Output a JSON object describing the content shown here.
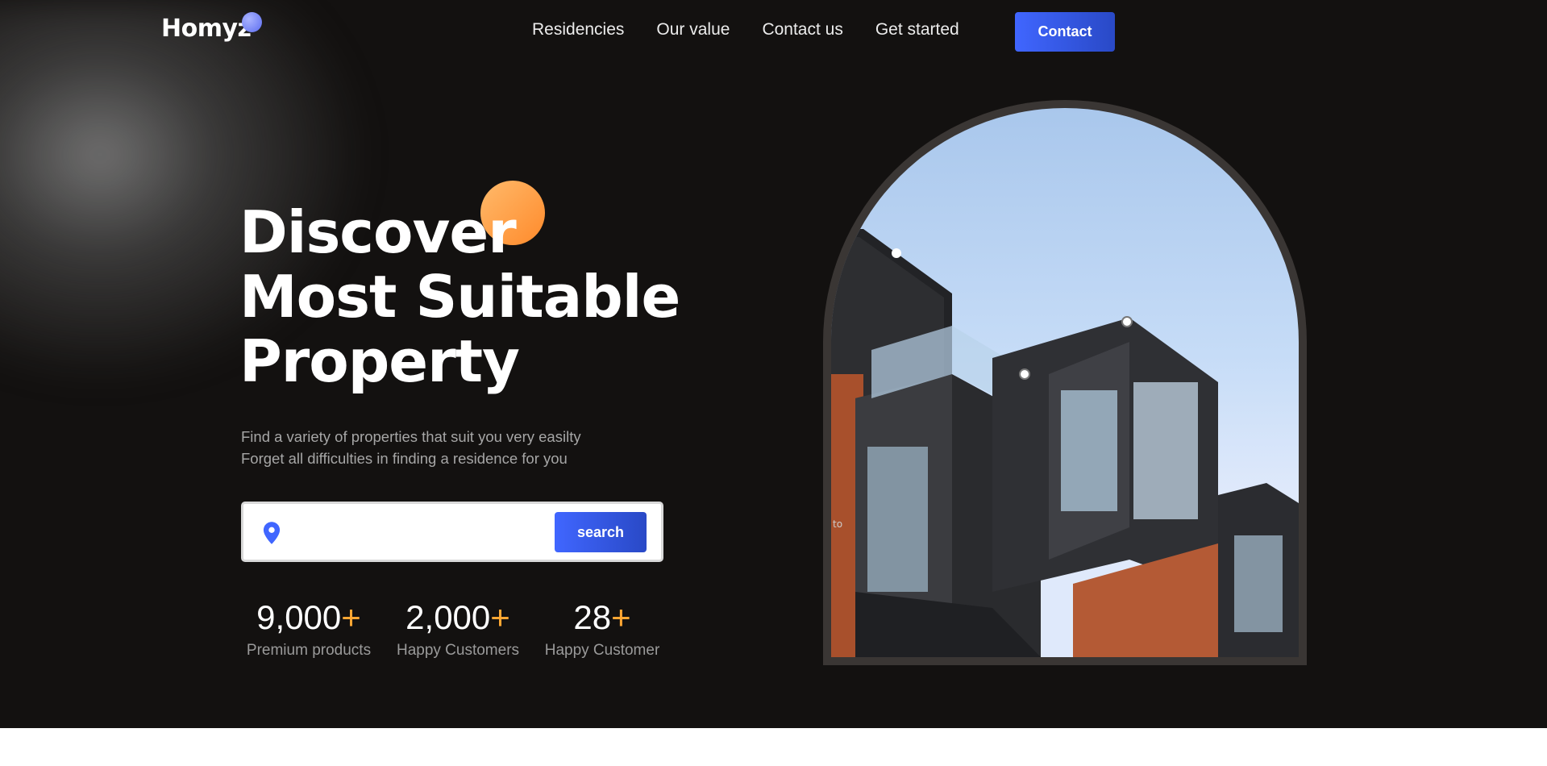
{
  "header": {
    "logo": "Homyz",
    "nav": [
      "Residencies",
      "Our value",
      "Contact us",
      "Get started"
    ],
    "contact_button": "Contact"
  },
  "hero": {
    "headline": [
      "Discover",
      "Most Suitable",
      "Property"
    ],
    "subtext": [
      "Find a variety of properties that suit you very easilty",
      "Forget all difficulties in finding a residence for you"
    ],
    "search": {
      "placeholder": "",
      "button_label": "search",
      "icon": "location-pin-icon"
    },
    "stats": [
      {
        "value": "9,000",
        "suffix": "+",
        "label": "Premium products"
      },
      {
        "value": "2,000",
        "suffix": "+",
        "label": "Happy Customers"
      },
      {
        "value": "28",
        "suffix": "+",
        "label": "Happy Customer"
      }
    ],
    "image_alt_fragment": "to"
  },
  "colors": {
    "background": "#131110",
    "accent_blue": "#4066ff",
    "accent_orange": "#ffa733"
  }
}
